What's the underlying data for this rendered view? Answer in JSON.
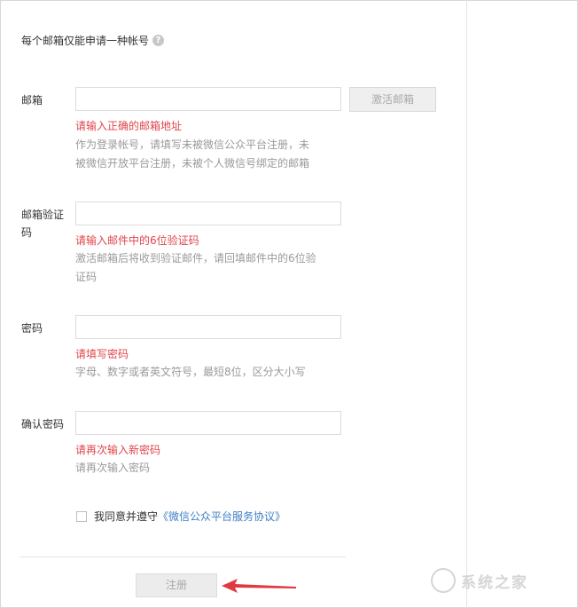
{
  "form": {
    "notice": "每个邮箱仅能申请一种帐号",
    "email": {
      "label": "邮箱",
      "activate_button": "激活邮箱",
      "error": "请输入正确的邮箱地址",
      "hint_line1": "作为登录帐号，请填写未被微信公众平台注册，未",
      "hint_line2": "被微信开放平台注册，未被个人微信号绑定的邮箱"
    },
    "code": {
      "label_line1": "邮箱验证",
      "label_line2": "码",
      "error": "请输入邮件中的6位验证码",
      "hint_line1": "激活邮箱后将收到验证邮件，请回填邮件中的6位验",
      "hint_line2": "证码"
    },
    "password": {
      "label": "密码",
      "error": "请填写密码",
      "hint": "字母、数字或者英文符号，最短8位，区分大小写"
    },
    "confirm_password": {
      "label": "确认密码",
      "error": "请再次输入新密码",
      "hint": "请再次输入密码"
    },
    "agreement": {
      "prefix": "我同意并遵守",
      "link": "《微信公众平台服务协议》"
    },
    "register_button": "注册"
  },
  "watermark": {
    "text": "系统之家"
  },
  "colors": {
    "error": "#e0454b",
    "link": "#3d7fc6",
    "arrow": "#e0393f"
  }
}
